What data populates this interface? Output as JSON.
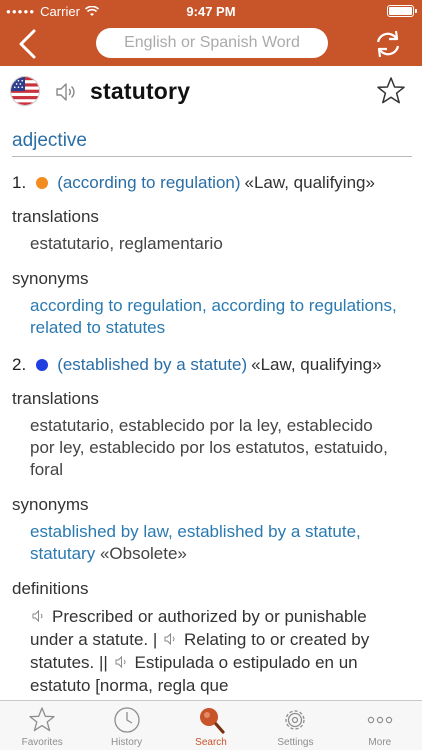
{
  "status_bar": {
    "carrier": "Carrier",
    "time": "9:47 PM"
  },
  "header": {
    "search_placeholder": "English or Spanish Word"
  },
  "entry": {
    "word": "statutory",
    "part_of_speech": "adjective",
    "senses": [
      {
        "number": "1.",
        "dot_color": "#f28c1e",
        "gloss": "(according to regulation)",
        "domain": "«Law, qualifying»",
        "translations_label": "translations",
        "translations": "estatutario, reglamentario",
        "synonyms_label": "synonyms",
        "synonyms": "according to regulation, according to regulations, related to statutes",
        "synonyms_note": ""
      },
      {
        "number": "2.",
        "dot_color": "#1f3fe0",
        "gloss": "(established by a statute)",
        "domain": "«Law, qualifying»",
        "translations_label": "translations",
        "translations": "estatutario, establecido por la ley, establecido por ley, establecido por los estatutos, estatuido, foral",
        "synonyms_label": "synonyms",
        "synonyms": "established by law, established by a statute, statutary",
        "synonyms_note": "«Obsolete»"
      }
    ],
    "definitions_label": "definitions",
    "definitions": [
      "Prescribed or authorized by or punishable under a statute. |",
      "Relating to or created by statutes. ||",
      "Estipulada o estipulado en un estatuto [norma, regla que"
    ]
  },
  "tabbar": {
    "tabs": [
      {
        "label": "Favorites",
        "icon": "star-icon"
      },
      {
        "label": "History",
        "icon": "clock-icon"
      },
      {
        "label": "Search",
        "icon": "magnifier-icon"
      },
      {
        "label": "Settings",
        "icon": "gear-icon"
      },
      {
        "label": "More",
        "icon": "ellipsis-icon"
      }
    ],
    "active_tab": "Search"
  },
  "colors": {
    "accent": "#c8542a",
    "link": "#2a7ab0",
    "pos": "#2a6ea6"
  }
}
